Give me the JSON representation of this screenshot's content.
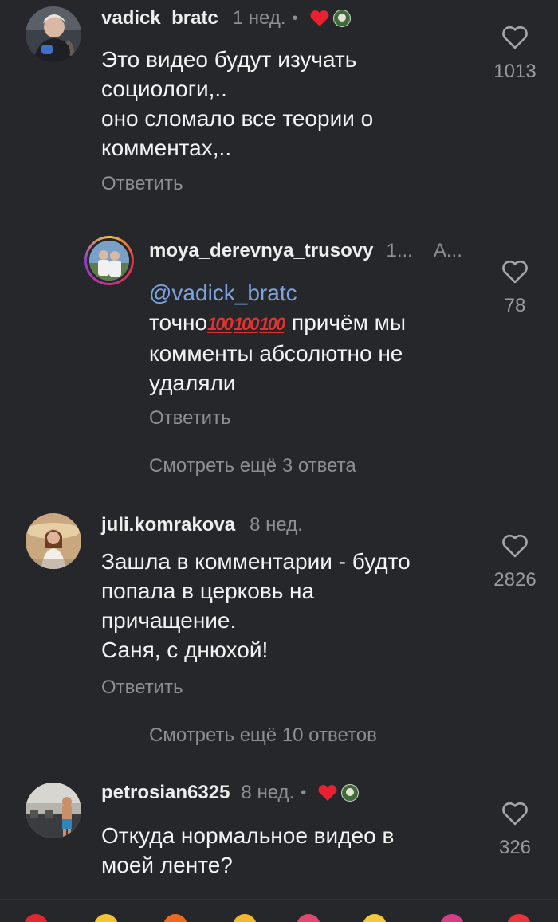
{
  "comments": [
    {
      "username": "vadick_bratc",
      "time": "1 нед.",
      "dot": "•",
      "lines": [
        "Это видео будут изучать",
        "социологи,..",
        "оно сломало все теории о",
        "комментах,.."
      ],
      "reply_label": "Ответить",
      "likes": "1013"
    },
    {
      "username": "moya_derevnya_trusovy",
      "time": "1...",
      "author_tag": "А...",
      "mention": "@vadick_bratc",
      "line1_prefix": "точно",
      "hundreds": [
        "100",
        "100",
        "100"
      ],
      "line1_suffix": " причём мы",
      "lines": [
        "комменты абсолютно не",
        "удаляли"
      ],
      "reply_label": "Ответить",
      "likes": "78",
      "more_replies": "Смотреть ещё 3 ответа"
    },
    {
      "username": "juli.komrakova",
      "time": "8 нед.",
      "lines": [
        "Зашла в комментарии - будто",
        "попала в церковь на",
        "причащение.",
        "Саня, с днюхой!"
      ],
      "reply_label": "Ответить",
      "likes": "2826",
      "more_replies": "Смотреть ещё 10 ответов"
    },
    {
      "username": "petrosian6325",
      "time": "8 нед.",
      "dot": "•",
      "lines": [
        "Откуда нормальное видео в",
        "моей ленте?"
      ],
      "likes": "326"
    }
  ],
  "colors": {
    "background": "#26272b",
    "secondary_text": "#8e8f94",
    "mention": "#7da4e0",
    "heart_badge": "#e8202f"
  },
  "emoji_bar": [
    "red-heart",
    "star-face",
    "fire",
    "sparkle-face",
    "party-popper",
    "smile",
    "party-face",
    "heart-eyes"
  ]
}
